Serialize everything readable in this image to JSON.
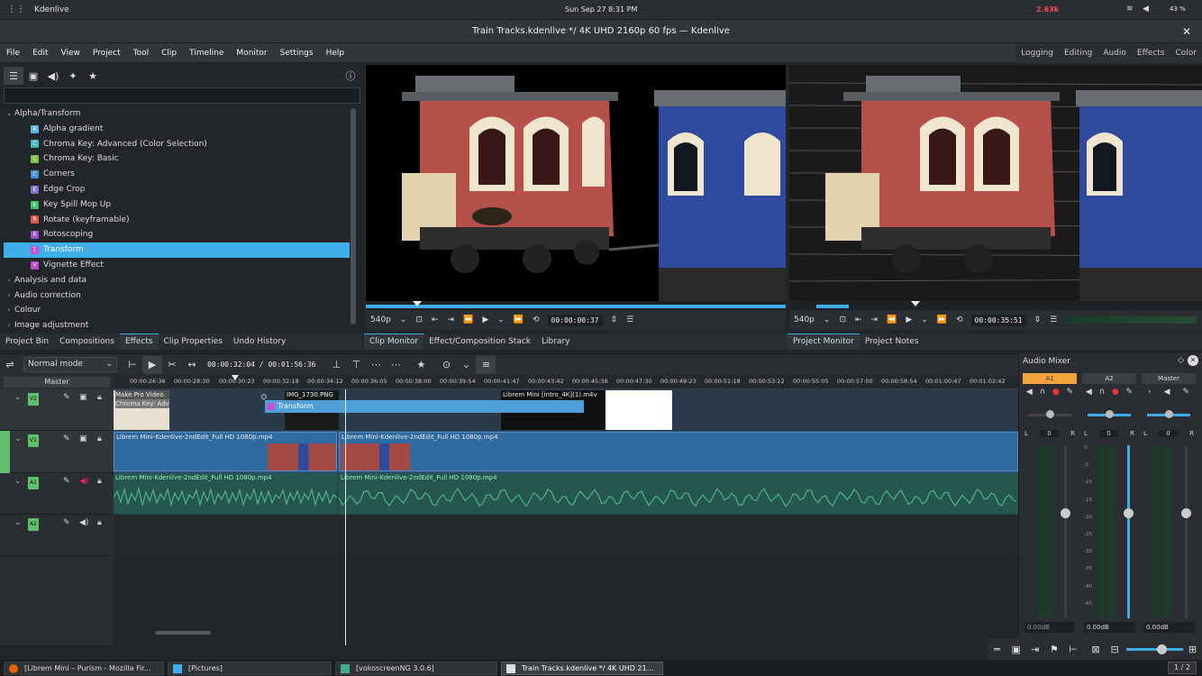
{
  "system_bar": {
    "app_name": "Kdenlive",
    "clock": "Sun Sep 27   8:31 PM",
    "net_speed": "2.63k",
    "battery": "43 %"
  },
  "window": {
    "title": "Train Tracks.kdenlive */ 4K UHD 2160p 60 fps — Kdenlive",
    "close_label": "✕"
  },
  "menu": [
    "File",
    "Edit",
    "View",
    "Project",
    "Tool",
    "Clip",
    "Timeline",
    "Monitor",
    "Settings",
    "Help"
  ],
  "layouts": [
    "Logging",
    "Editing",
    "Audio",
    "Effects",
    "Color"
  ],
  "effects": {
    "search_placeholder": "",
    "tree": [
      {
        "label": "Alpha/Transform",
        "expanded": true,
        "children": [
          {
            "label": "Alpha gradient",
            "badge": "A",
            "color": "#5ab4e8"
          },
          {
            "label": "Chroma Key: Advanced (Color Selection)",
            "badge": "C",
            "color": "#3fb8c8"
          },
          {
            "label": "Chroma Key: Basic",
            "badge": "C",
            "color": "#7cc24a"
          },
          {
            "label": "Corners",
            "badge": "C",
            "color": "#3f8fd8"
          },
          {
            "label": "Edge Crop",
            "badge": "E",
            "color": "#8a6fd6"
          },
          {
            "label": "Key Spill Mop Up",
            "badge": "K",
            "color": "#3fc16a"
          },
          {
            "label": "Rotate (keyframable)",
            "badge": "R",
            "color": "#e2574c"
          },
          {
            "label": "Rotoscoping",
            "badge": "R",
            "color": "#9a4fd0"
          },
          {
            "label": "Transform",
            "badge": "T",
            "color": "#c84fd0",
            "selected": true
          },
          {
            "label": "Vignette Effect",
            "badge": "V",
            "color": "#b848d0"
          }
        ]
      },
      {
        "label": "Analysis and data",
        "expanded": false
      },
      {
        "label": "Audio correction",
        "expanded": false
      },
      {
        "label": "Colour",
        "expanded": false
      },
      {
        "label": "Image adjustment",
        "expanded": false
      }
    ]
  },
  "left_tabs": [
    "Project Bin",
    "Compositions",
    "Effects",
    "Clip Properties",
    "Undo History"
  ],
  "clip_monitor": {
    "zoom": "540p",
    "timecode": "00:00:00:37",
    "tabs": [
      "Clip Monitor",
      "Effect/Composition Stack",
      "Library"
    ]
  },
  "project_monitor": {
    "zoom": "540p",
    "timecode": "00:00:35:51",
    "tabs": [
      "Project Monitor",
      "Project Notes"
    ]
  },
  "timeline": {
    "edit_mode": "Normal mode",
    "position": "00:00:32:04",
    "duration": "00:01:56:36",
    "master_label": "Master",
    "ruler_ticks": [
      "00:00:26:36",
      "00:00:28:30",
      "00:00:30:23",
      "00:00:32:18",
      "00:00:34:12",
      "00:00:36:05",
      "00:00:38:00",
      "00:00:39:54",
      "00:00:41:47",
      "00:00:43:42",
      "00:00:45:36",
      "00:00:47:30",
      "00:00:49:23",
      "00:00:51:18",
      "00:00:53:12",
      "00:00:55:05",
      "00:00:57:00",
      "00:00:58:54",
      "00:01:00:47",
      "00:01:02:42"
    ],
    "tracks": [
      {
        "name": "V2",
        "color": "#5fc16e"
      },
      {
        "name": "V1",
        "color": "#5fc16e"
      },
      {
        "name": "A1",
        "color": "#5fc16e"
      },
      {
        "name": "A2",
        "color": "#5fc16e"
      }
    ],
    "clips": {
      "v2_title": "Make Pro Video",
      "v2_title2": "Chroma Key: Adv",
      "v2_img": "IMG_1730.PNG",
      "v2_intro": "Librem Mini [intro_4K](1).m4v",
      "transform": "Transform",
      "v1_a": "Librem Mini-Kdenlive-2ndEdit_Full HD 1080p.mp4",
      "v1_b": "Librem Mini-Kdenlive-2ndEdit_Full HD 1080p.mp4",
      "a1_a": "Librem Mini-Kdenlive-2ndEdit_Full HD 1080p.mp4",
      "a1_b": "Librem Mini-Kdenlive-2ndEdit_Full HD 1080p.mp4"
    }
  },
  "mixer": {
    "title": "Audio Mixer",
    "channels": [
      {
        "name": "A1",
        "value": "0",
        "db": "0.00dB",
        "accent": "#f2a33a"
      },
      {
        "name": "A2",
        "value": "0",
        "db": "0.00dB"
      },
      {
        "name": "Master",
        "value": "0",
        "db": "0.00dB"
      }
    ],
    "scale": [
      "0",
      "-5",
      "-10",
      "-15",
      "-20",
      "-25",
      "-30",
      "-35",
      "-40",
      "-45"
    ]
  },
  "taskbar": [
    {
      "label": "[Librem Mini – Purism - Mozilla Fir...",
      "active": false
    },
    {
      "label": "[Pictures]",
      "active": false
    },
    {
      "label": "[vokoscreenNG 3.0.6]",
      "active": false
    },
    {
      "label": "Train Tracks.kdenlive */ 4K UHD 21...",
      "active": true
    }
  ],
  "pager": "1 / 2",
  "colors": {
    "accent": "#3daee9",
    "bg": "#232629",
    "clip_blue": "#2e6aa0",
    "audio_green": "#2e7d6a"
  }
}
